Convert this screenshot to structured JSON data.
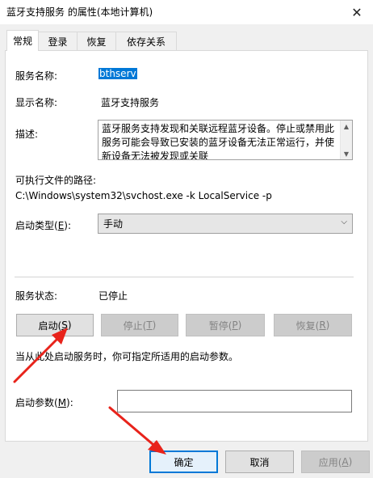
{
  "window": {
    "title": "蓝牙支持服务 的属性(本地计算机)",
    "close_glyph": "✕"
  },
  "tabs": [
    {
      "label": "常规"
    },
    {
      "label": "登录"
    },
    {
      "label": "恢复"
    },
    {
      "label": "依存关系"
    }
  ],
  "general": {
    "service_name_label": "服务名称:",
    "service_name_value": "bthserv",
    "display_name_label": "显示名称:",
    "display_name_value": "蓝牙支持服务",
    "description_label": "描述:",
    "description_value": "蓝牙服务支持发现和关联远程蓝牙设备。停止或禁用此服务可能会导致已安装的蓝牙设备无法正常运行，并使新设备无法被发现或关联",
    "exe_path_label": "可执行文件的路径:",
    "exe_path_value": "C:\\Windows\\system32\\svchost.exe -k LocalService -p",
    "startup_type_label_pre": "启动类型(",
    "startup_type_label_key": "E",
    "startup_type_label_post": "):",
    "startup_type_value": "手动",
    "status_label": "服务状态:",
    "status_value": "已停止",
    "buttons": {
      "start": {
        "pre": "启动(",
        "key": "S",
        "post": ")"
      },
      "stop": {
        "pre": "停止(",
        "key": "T",
        "post": ")"
      },
      "pause": {
        "pre": "暂停(",
        "key": "P",
        "post": ")"
      },
      "resume": {
        "pre": "恢复(",
        "key": "R",
        "post": ")"
      }
    },
    "hint": "当从此处启动服务时，你可指定所适用的启动参数。",
    "start_params_label_pre": "启动参数(",
    "start_params_label_key": "M",
    "start_params_label_post": "):",
    "start_params_value": ""
  },
  "footer": {
    "ok": "确定",
    "cancel": "取消",
    "apply_pre": "应用(",
    "apply_key": "A",
    "apply_post": ")"
  },
  "annotations": {
    "arrow_color": "#e8231b"
  },
  "icons": {
    "scroll_up": "▲",
    "scroll_down": "▼",
    "dropdown": "⌵"
  }
}
